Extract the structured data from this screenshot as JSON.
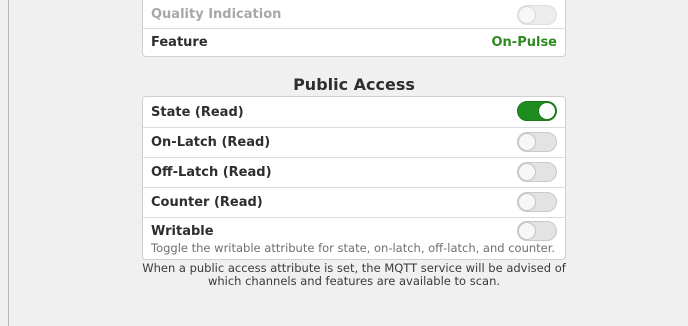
{
  "top_section": {
    "rows": [
      {
        "label": "Quality Indication",
        "toggle_on": false
      },
      {
        "label": "Feature",
        "value": "On-Pulse"
      }
    ]
  },
  "public_access": {
    "title": "Public Access",
    "rows": [
      {
        "label": "State (Read)",
        "toggle_on": true
      },
      {
        "label": "On-Latch (Read)",
        "toggle_on": false
      },
      {
        "label": "Off-Latch (Read)",
        "toggle_on": false
      },
      {
        "label": "Counter (Read)",
        "toggle_on": false
      },
      {
        "label": "Writable",
        "description": "Toggle the writable attribute for state, on-latch, off-latch, and counter.",
        "toggle_on": false
      }
    ],
    "footnote": "When a public access attribute is set, the MQTT service will be advised of which channels and features are available to scan."
  },
  "colors": {
    "accent_green": "#1f8c1f",
    "value_green": "#2e8b1f"
  }
}
